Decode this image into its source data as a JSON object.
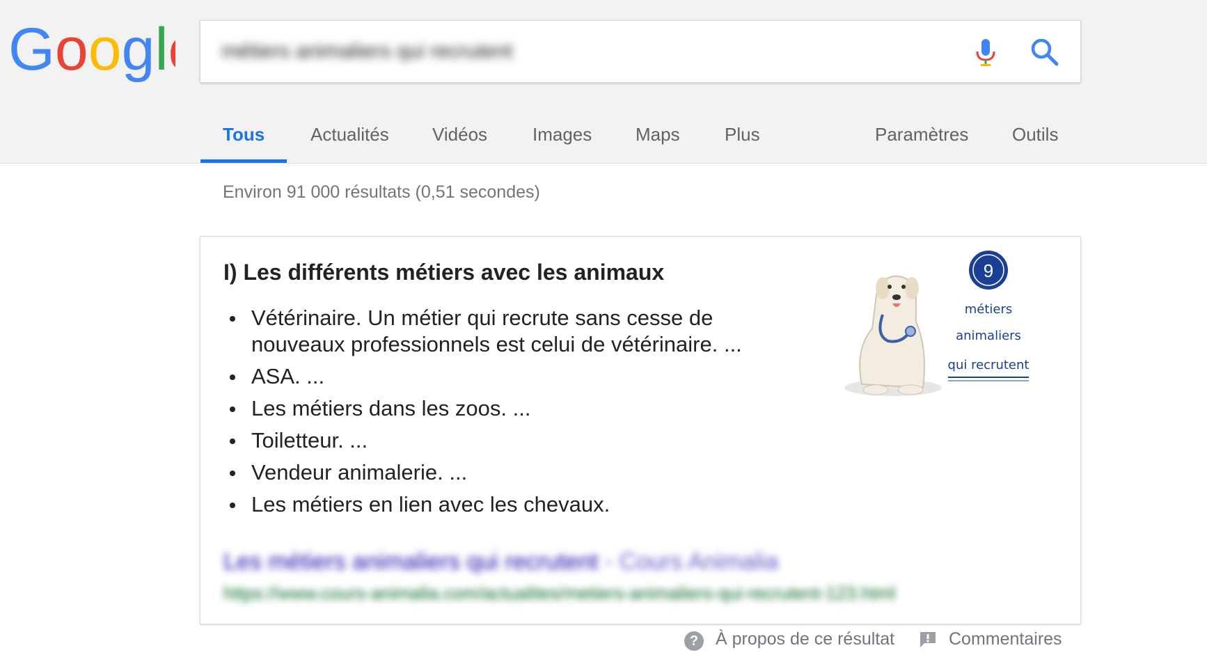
{
  "logo": {
    "text": "Google",
    "letters": [
      "G",
      "o",
      "o",
      "g",
      "l",
      "e"
    ],
    "colors": [
      "#4285f4",
      "#ea4335",
      "#fbbc05",
      "#4285f4",
      "#34a853",
      "#ea4335"
    ]
  },
  "search": {
    "query": "métiers animaliers qui recrutent",
    "mic_icon": "microphone-icon",
    "search_icon": "search-icon"
  },
  "tabs": [
    "Tous",
    "Actualités",
    "Vidéos",
    "Images",
    "Maps",
    "Plus"
  ],
  "tools": [
    "Paramètres",
    "Outils"
  ],
  "results_stats": "Environ 91 000 résultats (0,51 secondes)",
  "snippet": {
    "title": "I) Les différents métiers avec les animaux",
    "items": [
      "Vétérinaire. Un métier qui recrute sans cesse de nouveaux professionnels est celui de vétérinaire. ...",
      "ASA. ...",
      "Les métiers dans les zoos. ...",
      "Toiletteur. ...",
      "Vendeur animalerie. ...",
      "Les métiers en lien avec les chevaux."
    ],
    "image": {
      "badge_number": "9",
      "line1": "métiers",
      "line2": "animaliers",
      "line3": "qui recrutent"
    },
    "source_title": "Les métiers animaliers qui recrutent",
    "source_site": "- Cours Animalia",
    "source_url": "https://www.cours-animalia.com/actualites/metiers-animaliers-qui-recrutent-123.html"
  },
  "footer": {
    "about": "À propos de ce résultat",
    "feedback": "Commentaires",
    "help_icon_glyph": "?"
  },
  "colors": {
    "accent": "#1a73e8",
    "link": "#1a0dab",
    "url": "#006621",
    "gray": "#70757a"
  }
}
